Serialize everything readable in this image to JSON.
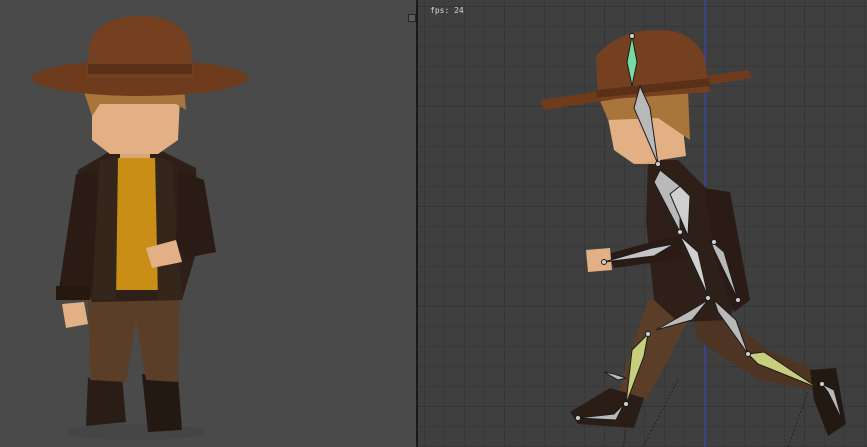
{
  "viewport_right": {
    "fps_label": "fps: 24"
  },
  "colors": {
    "left_background": "#4a4a4a",
    "right_background": "#3f3f3f",
    "hat": "#6e3c1c",
    "skin": "#e3b085",
    "hair": "#a8753a",
    "jacket": "#2e2018",
    "shirt": "#c98e16",
    "pants": "#5a3e28",
    "boots": "#2a1d15",
    "bone_default": "#b9b9b9",
    "bone_head": "#79d9a5",
    "bone_leg": "#c7cf7c",
    "z_axis": "#3d4bd9"
  },
  "icons": {
    "split_handle_left": "split-handle-icon",
    "split_handle_right": "split-handle-icon"
  }
}
